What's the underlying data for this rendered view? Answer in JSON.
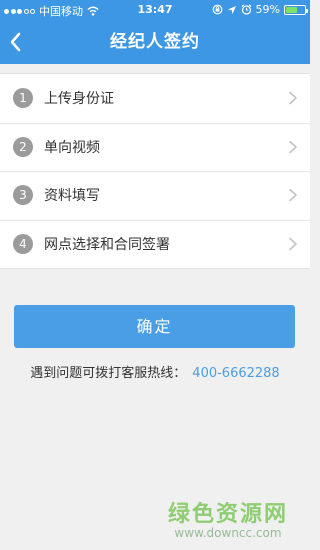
{
  "status_bar": {
    "carrier": "中国移动",
    "time": "13:47",
    "battery": "59%",
    "battery_level": 0.59,
    "icons": [
      "signal-icon",
      "wifi-icon",
      "rotation-lock-icon",
      "location-icon",
      "alarm-icon"
    ]
  },
  "nav": {
    "title": "经纪人签约",
    "back_icon": "chevron-left-icon"
  },
  "steps": [
    {
      "number": "1",
      "label": "上传身份证"
    },
    {
      "number": "2",
      "label": "单向视频"
    },
    {
      "number": "3",
      "label": "资料填写"
    },
    {
      "number": "4",
      "label": "网点选择和合同签署"
    }
  ],
  "confirm_button": "确定",
  "hotline": {
    "text": "遇到问题可拨打客服热线：",
    "number": "400-6662288"
  },
  "watermark": {
    "title": "绿色资源网",
    "url": "www.downcc.com"
  },
  "colors": {
    "header": "#3e97e4",
    "accent": "#4a9ee6",
    "background": "#f0f0f0"
  }
}
